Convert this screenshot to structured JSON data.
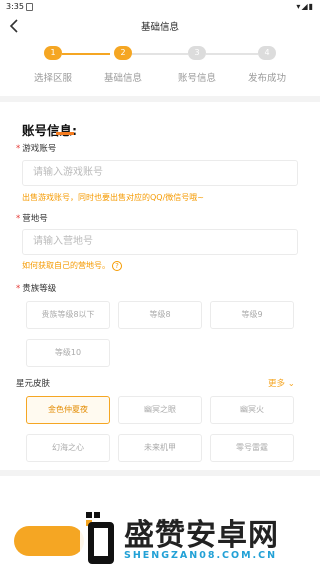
{
  "status_bar": {
    "time": "3:35",
    "right": "▾◢▮"
  },
  "header": {
    "title": "基础信息",
    "back_icon": "chevron-left-icon"
  },
  "steps": [
    {
      "num": "1",
      "label": "选择区服",
      "state": "done"
    },
    {
      "num": "2",
      "label": "基础信息",
      "state": "active"
    },
    {
      "num": "3",
      "label": "账号信息",
      "state": "pending"
    },
    {
      "num": "4",
      "label": "发布成功",
      "state": "pending"
    }
  ],
  "colors": {
    "accent": "#f5a623",
    "required": "#e53935",
    "underline": "#f57c20",
    "muted": "#cccccc"
  },
  "account_section": {
    "title": "账号信息:",
    "game_account": {
      "label": "游戏账号",
      "required": "*",
      "placeholder": "请输入游戏账号",
      "hint": "出售游戏账号，同时也要出售对应的QQ/微信号哦~"
    },
    "camp_id": {
      "label": "营地号",
      "required": "*",
      "placeholder": "请输入营地号",
      "hint": "如何获取自己的营地号。",
      "help": "?"
    },
    "noble_level": {
      "label": "贵族等级",
      "required": "*",
      "options": [
        "贵族等级8以下",
        "等级8",
        "等级9",
        "等级10"
      ]
    },
    "star_skins": {
      "label": "星元皮肤",
      "more": "更多 ⌄",
      "options": [
        "金色仲夏夜",
        "幽冥之眼",
        "幽冥火",
        "幻海之心",
        "未来机甲",
        "零号雷霆"
      ],
      "selected_index": 0
    }
  },
  "watermark": {
    "brand": "盛赞安卓网",
    "url": "SHENGZAN08.COM.CN"
  }
}
